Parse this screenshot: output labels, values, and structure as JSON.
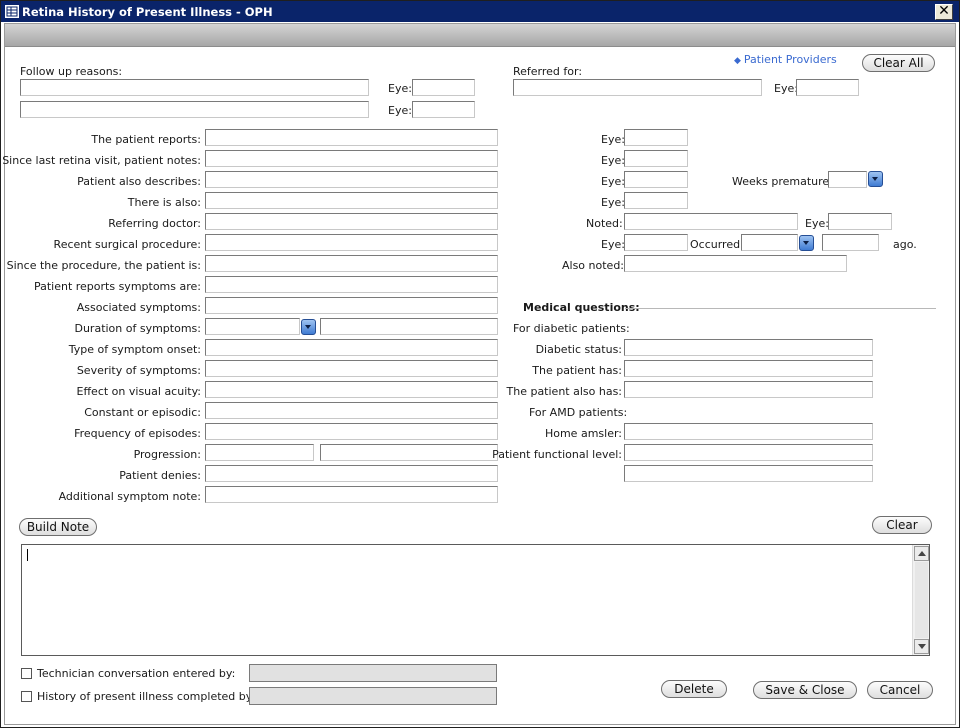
{
  "window": {
    "title": "Retina History of Present Illness - OPH",
    "close_glyph": "✕"
  },
  "top": {
    "follow_up_label": "Follow up reasons:",
    "eye_label": "Eye:",
    "referred_for_label": "Referred for:",
    "patient_providers_link": "Patient Providers",
    "clear_all_button": "Clear All"
  },
  "left_rows": [
    {
      "label": "The patient reports:"
    },
    {
      "label": "Since last retina visit, patient notes:"
    },
    {
      "label": "Patient also describes:"
    },
    {
      "label": "There is also:"
    },
    {
      "label": "Referring doctor:"
    },
    {
      "label": "Recent surgical procedure:"
    },
    {
      "label": "Since the procedure, the patient is:"
    },
    {
      "label": "Patient reports symptoms are:"
    },
    {
      "label": "Associated symptoms:"
    },
    {
      "label": "Duration of symptoms:"
    },
    {
      "label": "Type of symptom onset:"
    },
    {
      "label": "Severity of symptoms:"
    },
    {
      "label": "Effect on visual acuity:"
    },
    {
      "label": "Constant or episodic:"
    },
    {
      "label": "Frequency of episodes:"
    },
    {
      "label": "Progression:"
    },
    {
      "label": "Patient denies:"
    },
    {
      "label": "Additional symptom note:"
    }
  ],
  "right": {
    "eye_label": "Eye:",
    "weeks_premature_label": "Weeks premature:",
    "noted_label": "Noted:",
    "occurred_label": "Occurred:",
    "ago_label": "ago.",
    "also_noted_label": "Also noted:",
    "medical_questions_label": "Medical questions:",
    "for_diabetic_label": "For diabetic patients:",
    "diabetic_status_label": "Diabetic status:",
    "patient_has_label": "The patient has:",
    "patient_also_has_label": "The patient also has:",
    "for_amd_label": "For AMD patients:",
    "home_amsler_label": "Home amsler:",
    "functional_level_label": "Patient functional level:"
  },
  "buttons": {
    "build_note": "Build Note",
    "clear": "Clear",
    "delete": "Delete",
    "save_close": "Save & Close",
    "cancel": "Cancel"
  },
  "footer": {
    "technician_label": "Technician conversation entered by:",
    "hpi_completed_label": "History of present illness completed by:"
  },
  "note": {
    "text": ""
  },
  "icons": {
    "window_icon": "form-grid-icon",
    "dropdown_icon": "chevron-down-icon",
    "link_icon": "diamond-icon"
  },
  "colors": {
    "titlebar": "#0a246a",
    "link": "#3a6ad0",
    "dropdown": "#3f7bd2"
  }
}
